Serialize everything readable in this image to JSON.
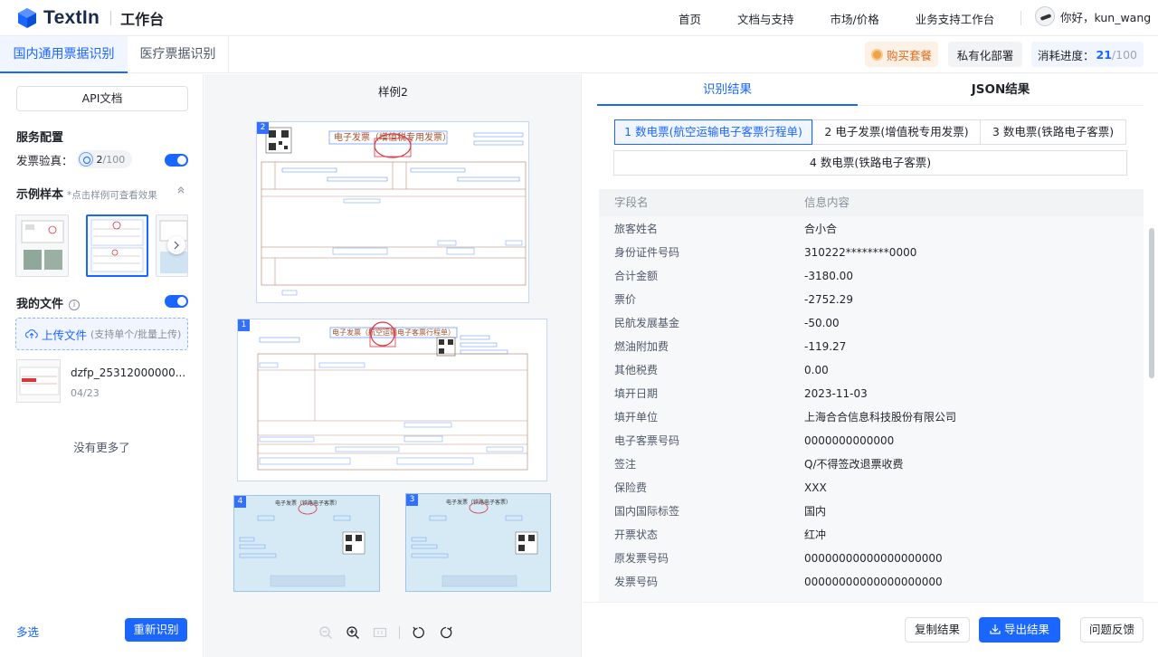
{
  "nav": {
    "logo_text": "TextIn",
    "workspace": "工作台",
    "links": [
      "首页",
      "文档与支持",
      "市场/价格",
      "业务支持工作台"
    ],
    "greeting": "你好，kun_wang"
  },
  "subbar": {
    "tabs": [
      "国内通用票据识别",
      "医疗票据识别"
    ],
    "buy_label": "购买套餐",
    "private_label": "私有化部署",
    "usage_label": "消耗进度：",
    "usage_used": "21",
    "usage_sep": "/",
    "usage_total": "100"
  },
  "left": {
    "api_doc": "API文档",
    "service_config": "服务配置",
    "verify_label": "发票验真：",
    "verify_used": "2",
    "verify_total": "/100",
    "verify_enabled": true,
    "samples_title": "示例样本",
    "samples_hint": "*点击样例可查看效果",
    "my_files": "我的文件",
    "info_glyph": "i",
    "my_files_enabled": true,
    "upload_label": "上传文件",
    "upload_hint": "(支持单个/批量上传)",
    "file": {
      "name": "dzfp_25312000000...",
      "date": "04/23"
    },
    "no_more": "没有更多了",
    "multi_select": "多选",
    "rerun": "重新识别"
  },
  "center": {
    "title": "样例2",
    "doc_numbers": [
      "2",
      "1",
      "4",
      "3"
    ],
    "doc2_title": "电子发票（增值税专用发票）",
    "doc1_title": "电子发票（航空运输电子客票行程单）",
    "doc4_title": "电子发票（铁路电子客票）",
    "doc3_title": "电子发票（铁路电子客票）"
  },
  "right": {
    "tabs": [
      "识别结果",
      "JSON结果"
    ],
    "chips": [
      "1 数电票(航空运输电子客票行程单)",
      "2 电子发票(增值税专用发票)",
      "3 数电票(铁路电子客票)",
      "4 数电票(铁路电子客票)"
    ],
    "columns": [
      "字段名",
      "信息内容"
    ],
    "rows": [
      {
        "field": "旅客姓名",
        "value": "合小合"
      },
      {
        "field": "身份证件号码",
        "value": "310222********0000"
      },
      {
        "field": "合计金额",
        "value": "-3180.00"
      },
      {
        "field": "票价",
        "value": "-2752.29"
      },
      {
        "field": "民航发展基金",
        "value": "-50.00"
      },
      {
        "field": "燃油附加费",
        "value": "-119.27"
      },
      {
        "field": "其他税费",
        "value": "0.00"
      },
      {
        "field": "填开日期",
        "value": "2023-11-03"
      },
      {
        "field": "填开单位",
        "value": "上海合合信息科技股份有限公司"
      },
      {
        "field": "电子客票号码",
        "value": "0000000000000"
      },
      {
        "field": "签注",
        "value": "Q/不得签改退票收费"
      },
      {
        "field": "保险费",
        "value": "XXX"
      },
      {
        "field": "国内国际标签",
        "value": "国内"
      },
      {
        "field": "开票状态",
        "value": "红冲"
      },
      {
        "field": "原发票号码",
        "value": "00000000000000000000"
      },
      {
        "field": "发票号码",
        "value": "00000000000000000000"
      }
    ],
    "copy_label": "复制结果",
    "export_label": "导出结果",
    "feedback_label": "问题反馈"
  },
  "colors": {
    "primary": "#1a66ff",
    "accent_orange": "#d96b1a",
    "stamp_red": "#d9363e"
  }
}
